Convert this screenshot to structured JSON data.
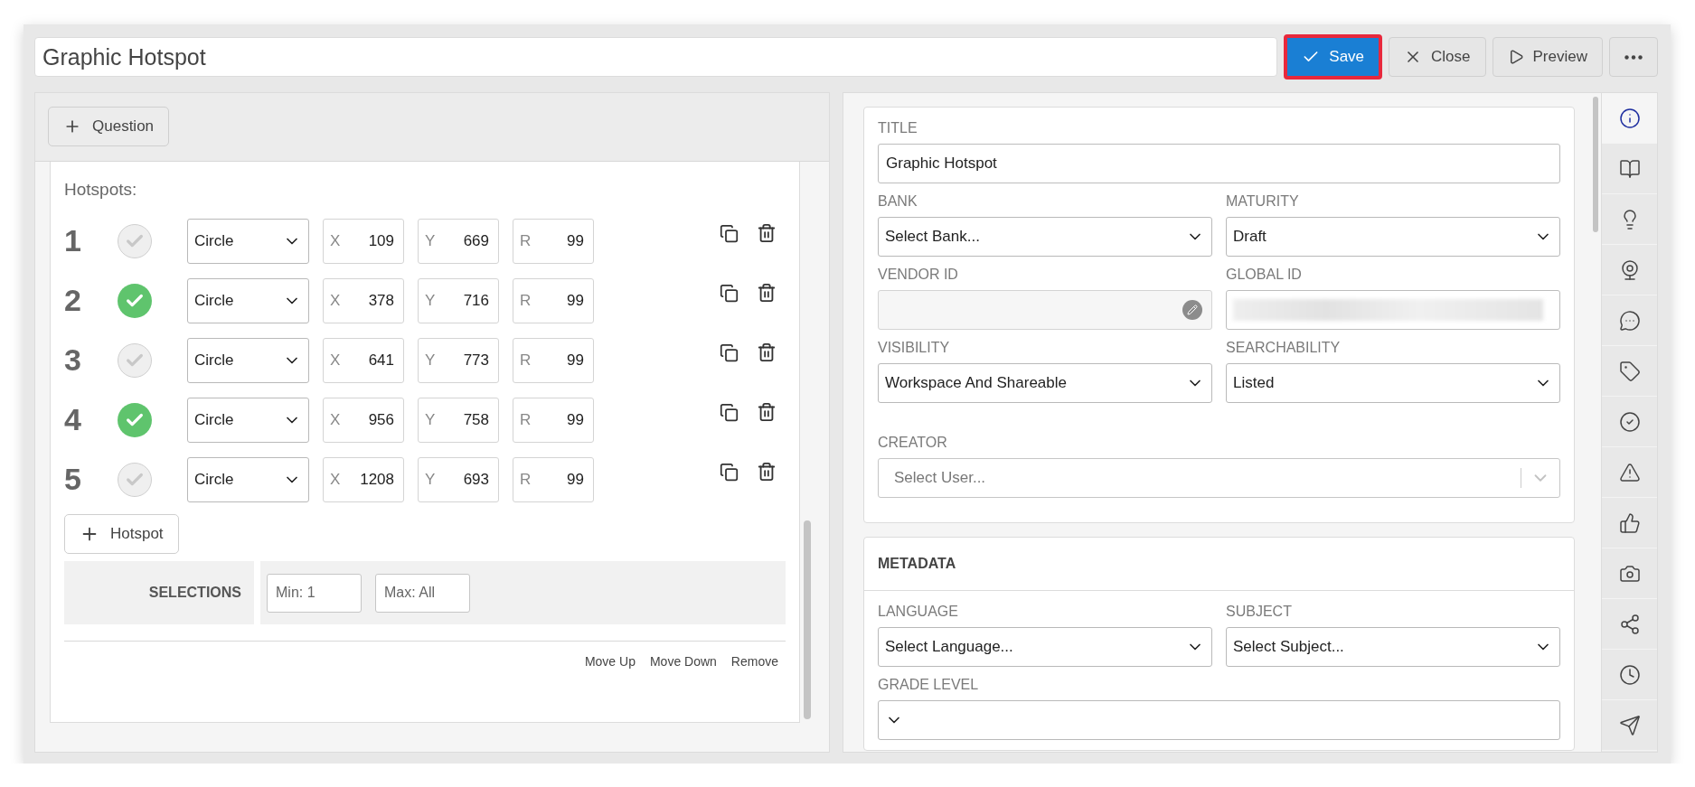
{
  "title_field": {
    "value": "Graphic Hotspot"
  },
  "toolbar": [
    {
      "kind": "save",
      "label": "Save",
      "highlighted": true
    },
    {
      "kind": "close",
      "label": "Close",
      "highlighted": false
    },
    {
      "kind": "preview",
      "label": "Preview",
      "highlighted": false
    },
    {
      "kind": "more",
      "highlighted": false
    }
  ],
  "question_panel": {
    "add_question_button": "Question",
    "hotspots_heading": "Hotspots:",
    "hotspots": [
      {
        "number": "1",
        "correct": false,
        "shape": "Circle",
        "fields": [
          {
            "label": "X",
            "value": "109"
          },
          {
            "label": "Y",
            "value": "669"
          },
          {
            "label": "R",
            "value": "99"
          }
        ]
      },
      {
        "number": "2",
        "correct": true,
        "shape": "Circle",
        "fields": [
          {
            "label": "X",
            "value": "378"
          },
          {
            "label": "Y",
            "value": "716"
          },
          {
            "label": "R",
            "value": "99"
          }
        ]
      },
      {
        "number": "3",
        "correct": false,
        "shape": "Circle",
        "fields": [
          {
            "label": "X",
            "value": "641"
          },
          {
            "label": "Y",
            "value": "773"
          },
          {
            "label": "R",
            "value": "99"
          }
        ]
      },
      {
        "number": "4",
        "correct": true,
        "shape": "Circle",
        "fields": [
          {
            "label": "X",
            "value": "956"
          },
          {
            "label": "Y",
            "value": "758"
          },
          {
            "label": "R",
            "value": "99"
          }
        ]
      },
      {
        "number": "5",
        "correct": false,
        "shape": "Circle",
        "fields": [
          {
            "label": "X",
            "value": "1208"
          },
          {
            "label": "Y",
            "value": "693"
          },
          {
            "label": "R",
            "value": "99"
          }
        ]
      }
    ],
    "add_hotspot_button": "Hotspot",
    "selections": {
      "label": "SELECTIONS",
      "min_placeholder": "Min: 1",
      "max_placeholder": "Max: All"
    },
    "actions": [
      "Move Up",
      "Move Down",
      "Remove"
    ]
  },
  "details": {
    "rows": [
      [
        {
          "kind": "text",
          "label": "TITLE",
          "value": "Graphic Hotspot",
          "disabled": false
        }
      ],
      [
        {
          "kind": "select",
          "label": "BANK",
          "value": "Select Bank..."
        },
        {
          "kind": "select",
          "label": "MATURITY",
          "value": "Draft"
        }
      ],
      [
        {
          "kind": "text",
          "label": "VENDOR ID",
          "disabled": true
        },
        {
          "kind": "redacted",
          "label": "GLOBAL ID"
        }
      ],
      [
        {
          "kind": "select",
          "label": "VISIBILITY",
          "value": "Workspace And Shareable"
        },
        {
          "kind": "select",
          "label": "SEARCHABILITY",
          "value": "Listed"
        }
      ],
      [
        {
          "kind": "combobox",
          "label": "CREATOR",
          "placeholder": "Select User..."
        }
      ]
    ]
  },
  "metadata": {
    "heading": "METADATA",
    "rows": [
      [
        {
          "kind": "select",
          "label": "LANGUAGE",
          "value": "Select Language..."
        },
        {
          "kind": "select",
          "label": "SUBJECT",
          "value": "Select Subject..."
        }
      ],
      [
        {
          "kind": "select",
          "label": "GRADE LEVEL"
        }
      ]
    ]
  },
  "side_nav": [
    {
      "selected": true
    },
    {
      "selected": false
    },
    {
      "selected": false
    },
    {
      "selected": false
    },
    {
      "selected": false
    },
    {
      "selected": false
    },
    {
      "selected": false
    },
    {
      "selected": false
    },
    {
      "selected": false
    },
    {
      "selected": false
    },
    {
      "selected": false
    },
    {
      "selected": false
    },
    {
      "selected": false
    }
  ]
}
